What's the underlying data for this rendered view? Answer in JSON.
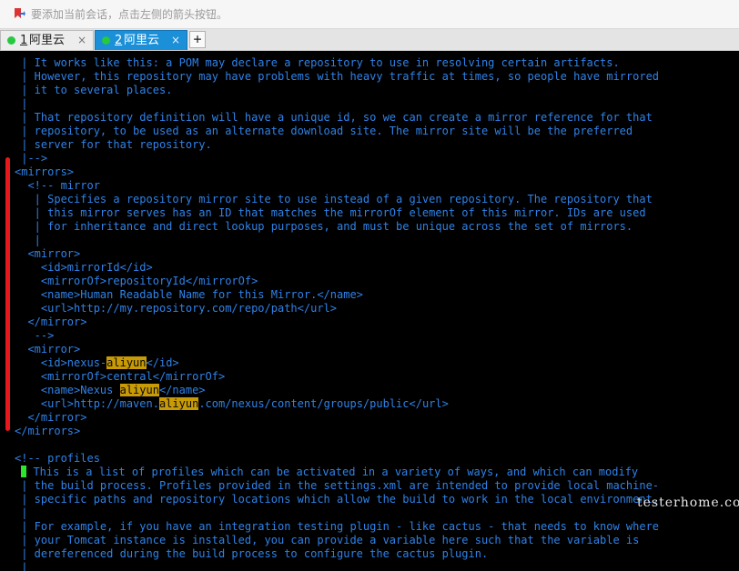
{
  "topbar": {
    "hint": "要添加当前会话，点击左侧的箭头按钮。",
    "icon": "bookmark-arrow-icon"
  },
  "tabs": [
    {
      "num": "1",
      "title": "阿里云",
      "close": "×",
      "active": false,
      "status_color": "#27c93f"
    },
    {
      "num": "2",
      "title": "阿里云",
      "close": "×",
      "active": true,
      "status_color": "#27c93f"
    }
  ],
  "add_tab_label": "+",
  "terminal": {
    "lines": [
      " | It works like this: a POM may declare a repository to use in resolving certain artifacts.",
      " | However, this repository may have problems with heavy traffic at times, so people have mirrored",
      " | it to several places.",
      " |",
      " | That repository definition will have a unique id, so we can create a mirror reference for that",
      " | repository, to be used as an alternate download site. The mirror site will be the preferred",
      " | server for that repository.",
      " |-->",
      "<mirrors>",
      "  <!-- mirror",
      "   | Specifies a repository mirror site to use instead of a given repository. The repository that",
      "   | this mirror serves has an ID that matches the mirrorOf element of this mirror. IDs are used",
      "   | for inheritance and direct lookup purposes, and must be unique across the set of mirrors.",
      "   |",
      "  <mirror>",
      "    <id>mirrorId</id>",
      "    <mirrorOf>repositoryId</mirrorOf>",
      "    <name>Human Readable Name for this Mirror.</name>",
      "    <url>http://my.repository.com/repo/path</url>",
      "  </mirror>",
      "   -->",
      "  <mirror>",
      "    <id>nexus-aliyun</id>",
      "    <mirrorOf>central</mirrorOf>",
      "    <name>Nexus aliyun</name>",
      "    <url>http://maven.aliyun.com/nexus/content/groups/public</url>",
      "  </mirror>",
      "</mirrors>",
      "",
      "<!-- profiles",
      " | This is a list of profiles which can be activated in a variety of ways, and which can modify",
      " | the build process. Profiles provided in the settings.xml are intended to provide local machine-",
      " | specific paths and repository locations which allow the build to work in the local environment.",
      " |",
      " | For example, if you have an integration testing plugin - like cactus - that needs to know where",
      " | your Tomcat instance is installed, you can provide a variable here such that the variable is",
      " | dereferenced during the build process to configure the cactus plugin.",
      " |"
    ],
    "highlight_word": "aliyun",
    "highlight_color": "#c89a05",
    "text_color": "#2f82e8",
    "cursor_color": "#2ee52e"
  },
  "watermark": "testerhome.com",
  "annotation_color": "#e8181a"
}
